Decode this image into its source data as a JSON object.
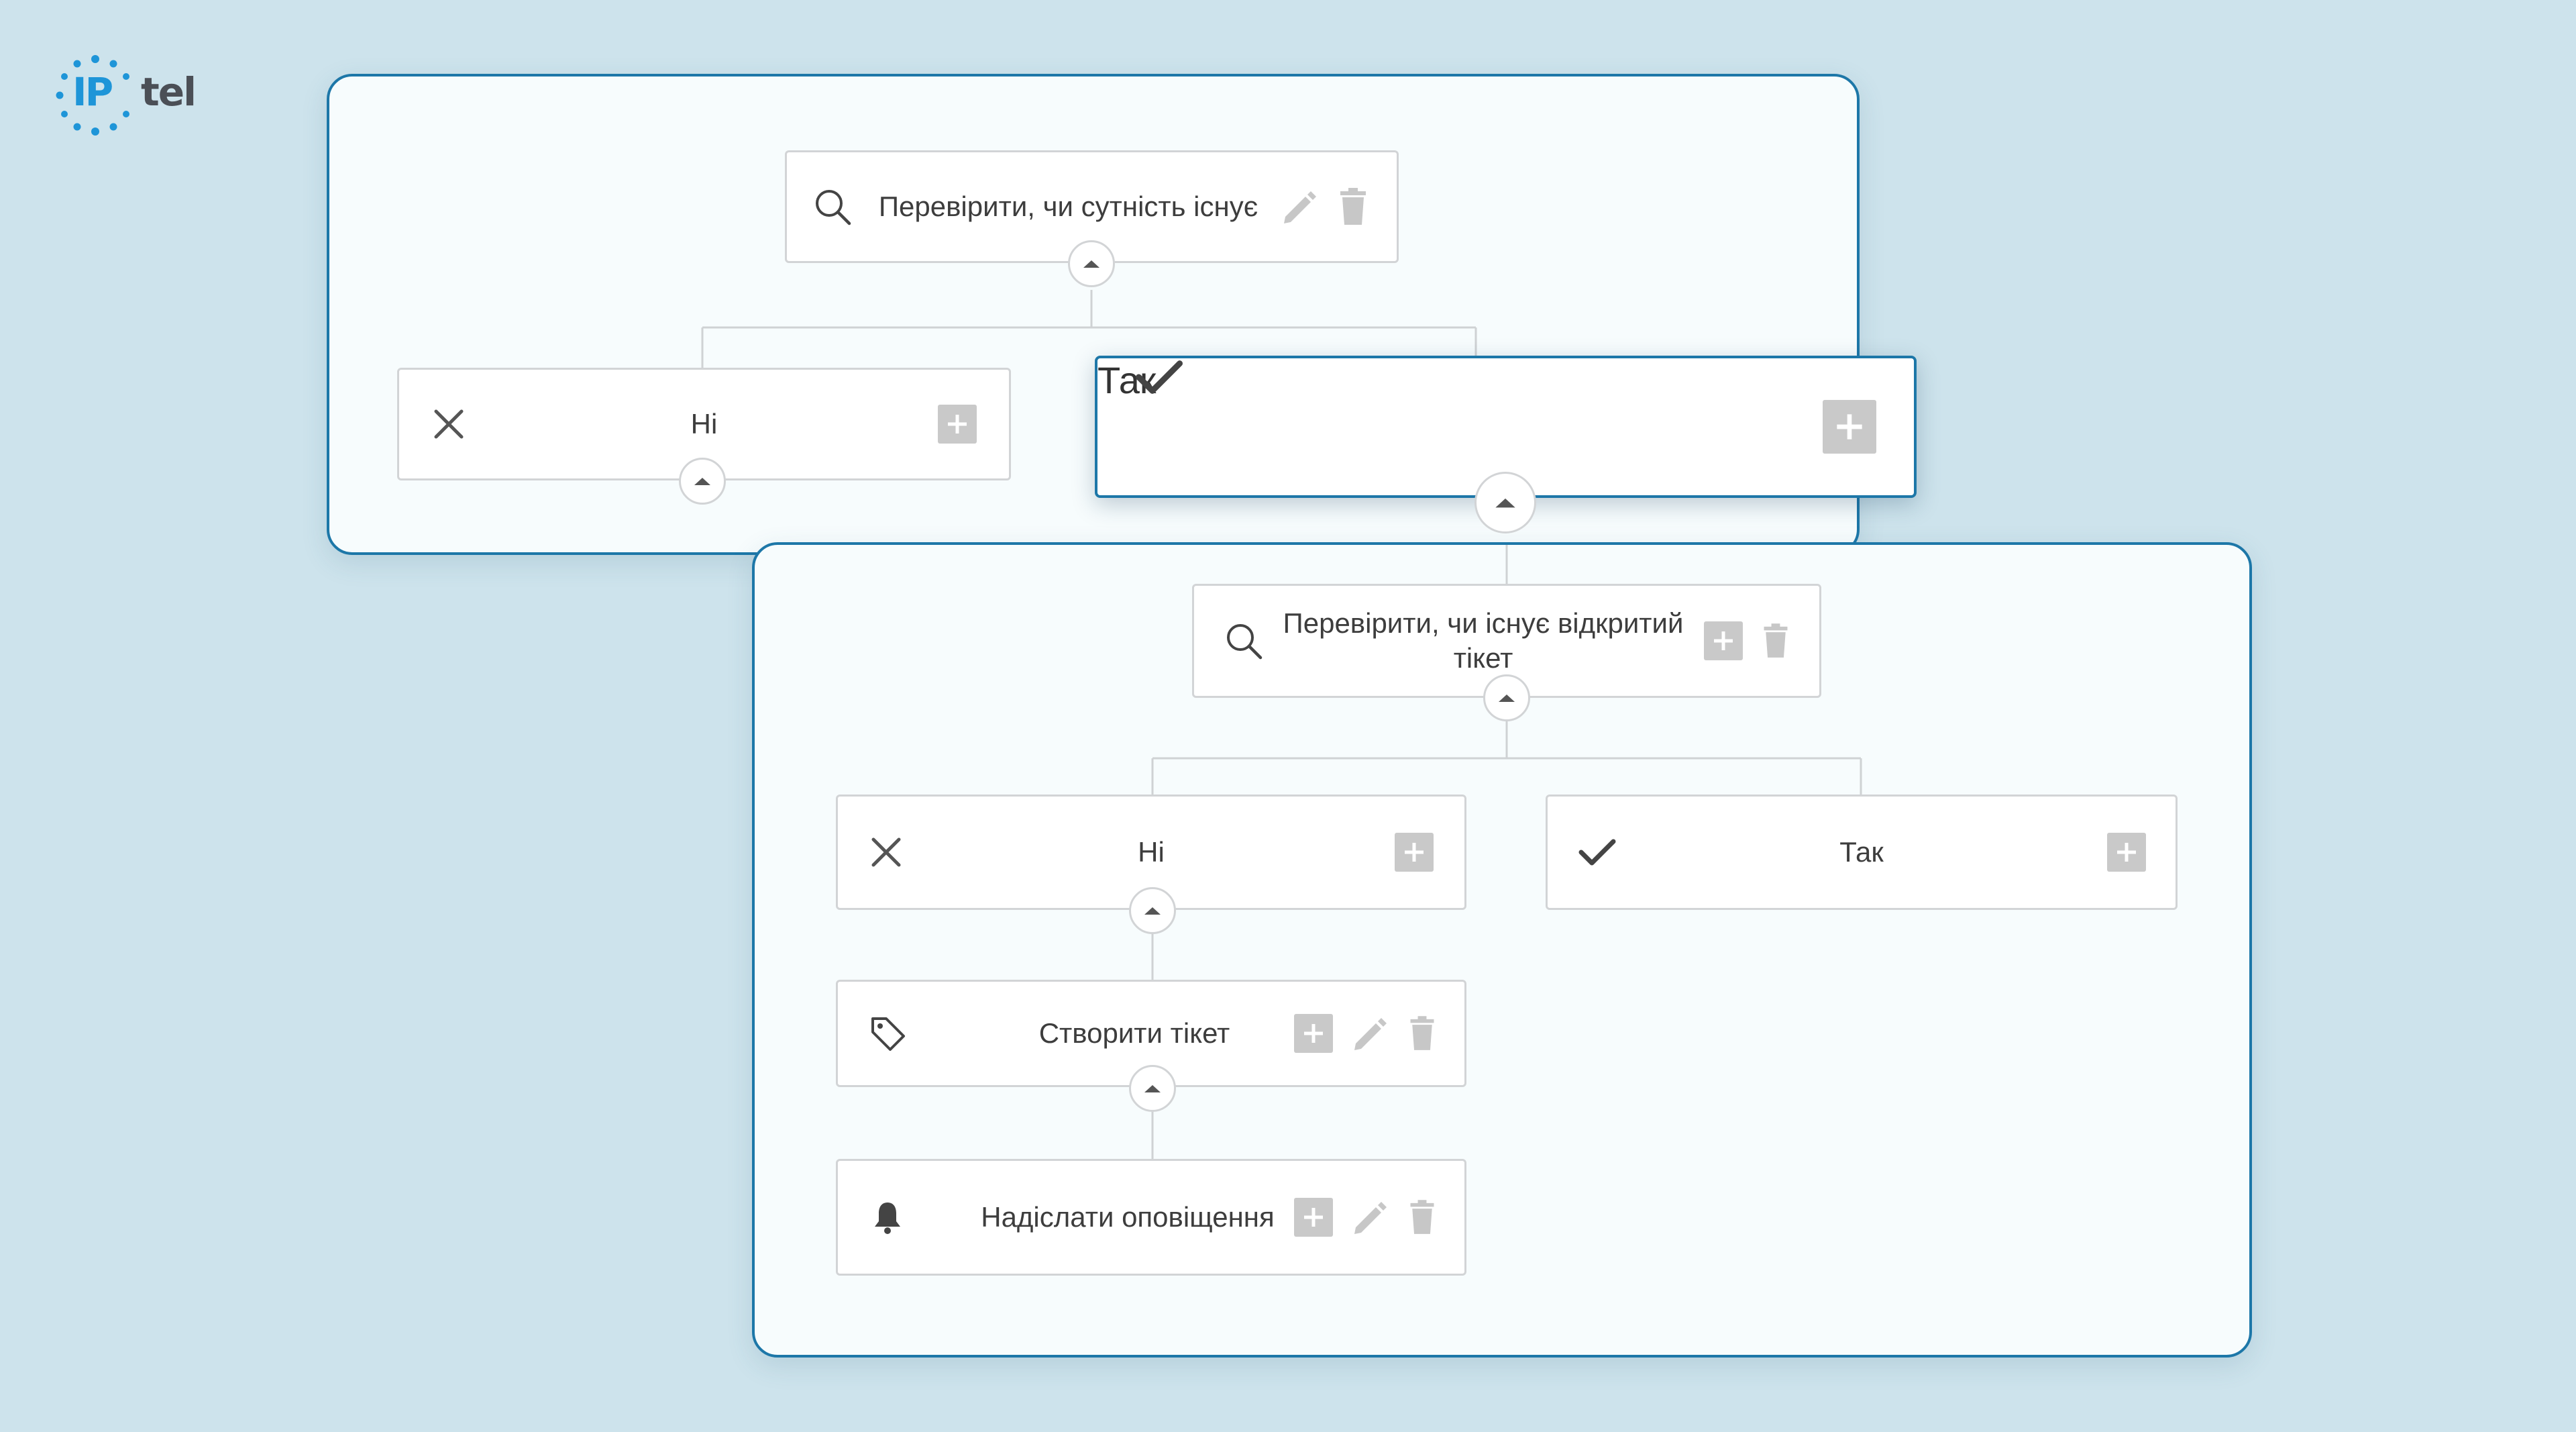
{
  "brand": {
    "logo_prefix": "IP",
    "logo_suffix": "tel",
    "accent": "#1e95d8",
    "panel_border": "#1d77a8",
    "background": "#cde3ec"
  },
  "flow1": {
    "check": {
      "label": "Перевірити, чи сутність існує",
      "icon": "search-icon",
      "actions": [
        "pencil-icon",
        "trash-icon"
      ]
    },
    "no": {
      "label": "Ні",
      "icon": "close-icon",
      "actions": [
        "plus-icon"
      ]
    },
    "yes": {
      "label": "Так",
      "icon": "check-icon",
      "actions": [
        "plus-icon"
      ],
      "highlighted": true
    }
  },
  "flow2": {
    "check": {
      "label": "Перевірити, чи існує відкритий тікет",
      "icon": "search-icon",
      "actions": [
        "plus-icon",
        "trash-icon"
      ]
    },
    "no": {
      "label": "Ні",
      "icon": "close-icon",
      "actions": [
        "plus-icon"
      ]
    },
    "yes": {
      "label": "Так",
      "icon": "check-icon",
      "actions": [
        "plus-icon"
      ]
    },
    "create_ticket": {
      "label": "Створити тікет",
      "icon": "tag-icon",
      "actions": [
        "plus-icon",
        "pencil-icon",
        "trash-icon"
      ]
    },
    "notify": {
      "label": "Надіслати оповіщення",
      "icon": "bell-icon",
      "actions": [
        "plus-icon",
        "pencil-icon",
        "trash-icon"
      ]
    }
  }
}
